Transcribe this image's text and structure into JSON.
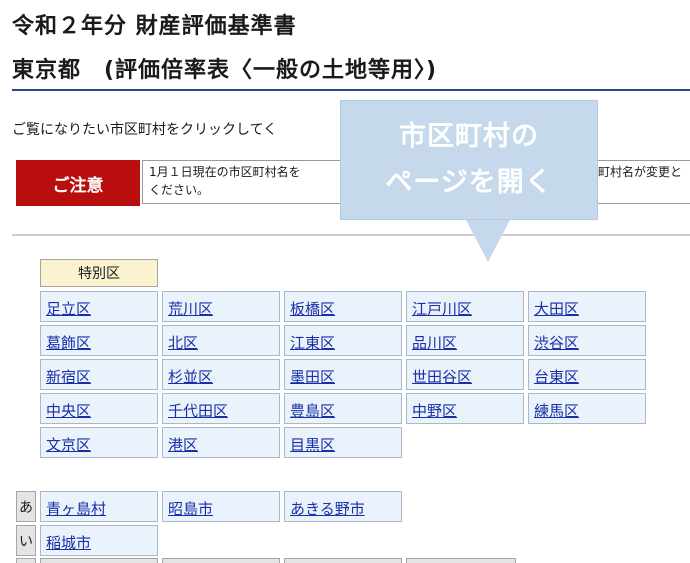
{
  "header": {
    "title_line1": "令和２年分 財産評価基準書",
    "title_line2": "東京都　(評価倍率表〈一般の土地等用〉)"
  },
  "instruction": "ご覧になりたい市区町村をクリックしてく",
  "notice": {
    "label": "ご注意",
    "line1": "1月１日現在の市区町村名を",
    "line2": "ください。",
    "right_fragment": "町村名が変更と"
  },
  "callout": {
    "line1": "市区町村の",
    "line2": "ページを開く"
  },
  "special_wards": {
    "header": "特別区",
    "items": [
      "足立区",
      "荒川区",
      "板橋区",
      "江戸川区",
      "大田区",
      "葛飾区",
      "北区",
      "江東区",
      "品川区",
      "渋谷区",
      "新宿区",
      "杉並区",
      "墨田区",
      "世田谷区",
      "台東区",
      "中央区",
      "千代田区",
      "豊島区",
      "中野区",
      "練馬区",
      "文京区",
      "港区",
      "目黒区"
    ]
  },
  "kana_groups": [
    {
      "kana": "あ",
      "items": [
        "青ヶ島村",
        "昭島市",
        "あきる野市"
      ]
    },
    {
      "kana": "い",
      "items": [
        "稲城市"
      ]
    }
  ],
  "colors": {
    "accent_blue": "#2b4a8b",
    "notice_red": "#b80e0e",
    "link": "#1a2fa7",
    "cell_bg": "#eaf3fc",
    "header_cell_bg": "#fbf3cf",
    "callout_bg": "#c5d8ec"
  }
}
